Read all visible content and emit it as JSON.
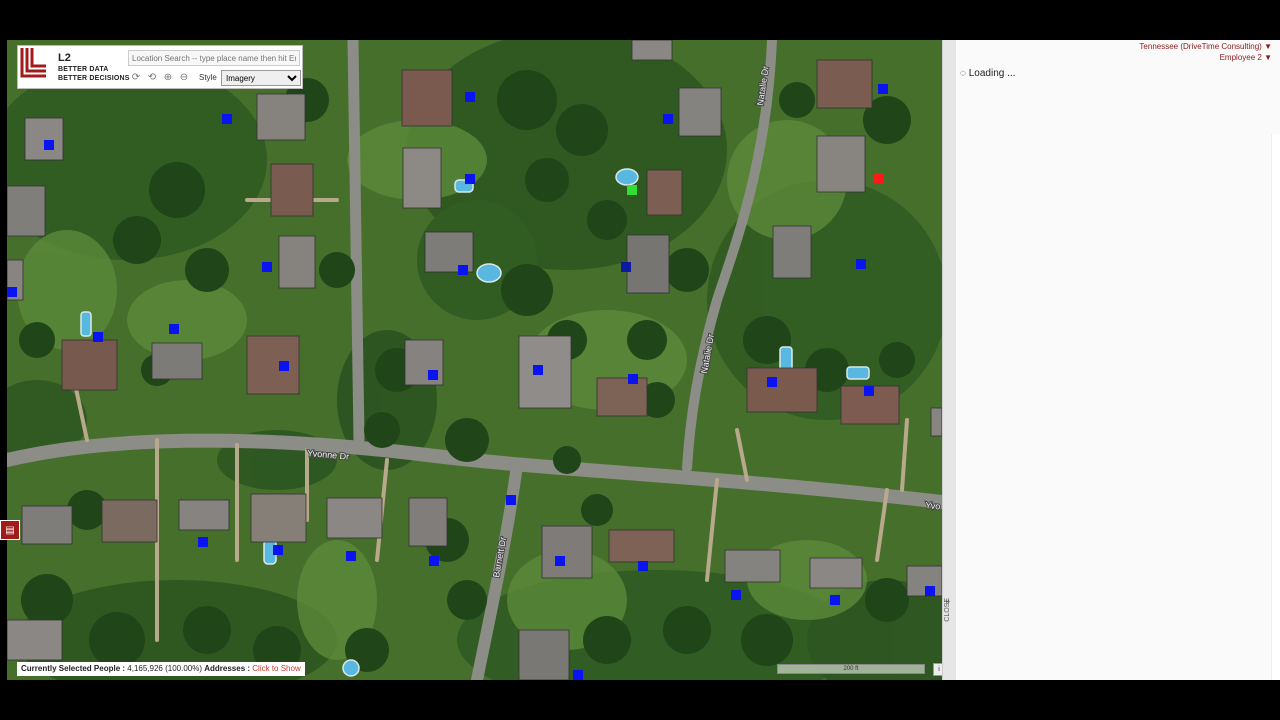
{
  "logo": {
    "mark": "L2",
    "name": "L2",
    "tagline_1": "BETTER DATA",
    "tagline_2": "BETTER DECISIONS"
  },
  "search": {
    "placeholder": "Location Search -- type place name then hit Ente"
  },
  "toolbar": {
    "tools": [
      "refresh-icon",
      "rotate-icon",
      "zoom-in-icon",
      "zoom-out-icon"
    ],
    "style_label": "Style",
    "style_value": "Imagery"
  },
  "map": {
    "road_names": {
      "yvonne": "Yvonne Dr",
      "yvonne_edge": "Yvo",
      "natalie_north": "Natalie Dr",
      "natalie_south": "Natalie Dr",
      "barnett": "Barnett Dr"
    },
    "scale_text": "200 ft",
    "info_label": "i",
    "marker_colors": {
      "default": "#0a14f0",
      "selected_red": "#ff1a1a",
      "selected_green": "#33dd33",
      "dark": "#0b1aa0"
    }
  },
  "status": {
    "label": "Currently Selected People :",
    "value": "4,165,926 (100.00%)",
    "addresses_label": "Addresses :",
    "addresses_link": "Click to Show"
  },
  "panel": {
    "account": "Tennessee (DriveTime Consulting)",
    "user": "Employee 2",
    "loading_text": "Loading ...",
    "close_label": "CLOSE"
  }
}
